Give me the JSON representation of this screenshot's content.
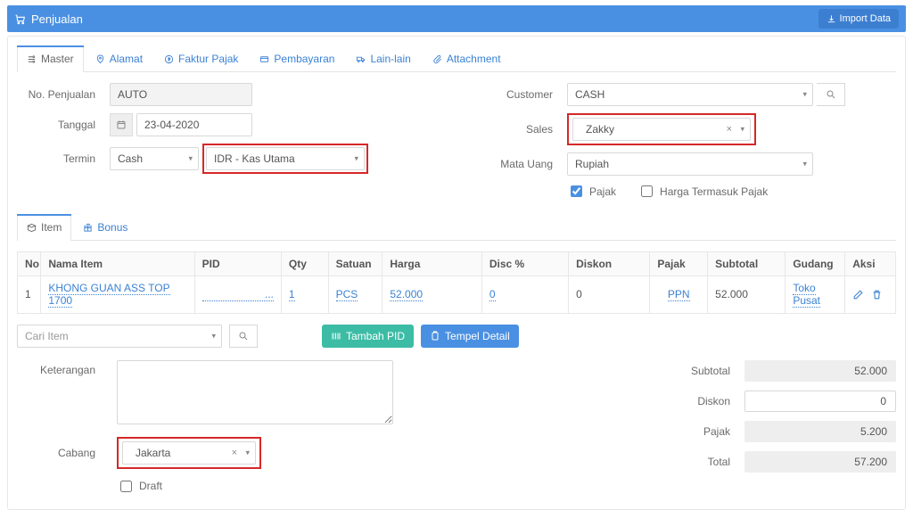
{
  "header": {
    "title": "Penjualan",
    "import_btn": "Import Data"
  },
  "tabs": [
    {
      "label": "Master"
    },
    {
      "label": "Alamat"
    },
    {
      "label": "Faktur Pajak"
    },
    {
      "label": "Pembayaran"
    },
    {
      "label": "Lain-lain"
    },
    {
      "label": "Attachment"
    }
  ],
  "form": {
    "labels": {
      "no_penjualan": "No. Penjualan",
      "tanggal": "Tanggal",
      "termin": "Termin",
      "customer": "Customer",
      "sales": "Sales",
      "mata_uang": "Mata Uang"
    },
    "no_penjualan": "AUTO",
    "tanggal": "23-04-2020",
    "termin": "Cash",
    "kas": "IDR - Kas Utama",
    "customer": "CASH",
    "sales": "Zakky",
    "mata_uang": "Rupiah",
    "pajak_label": "Pajak",
    "pajak_checked": true,
    "harga_termasuk_pajak_label": "Harga Termasuk Pajak",
    "harga_termasuk_pajak_checked": false
  },
  "item_tabs": [
    {
      "label": "Item"
    },
    {
      "label": "Bonus"
    }
  ],
  "item_cols": {
    "no": "No",
    "nama": "Nama Item",
    "pid": "PID",
    "qty": "Qty",
    "satuan": "Satuan",
    "harga": "Harga",
    "disc_pct": "Disc %",
    "diskon": "Diskon",
    "pajak": "Pajak",
    "subtotal": "Subtotal",
    "gudang": "Gudang",
    "aksi": "Aksi"
  },
  "items": [
    {
      "no": "1",
      "nama": "KHONG GUAN ASS TOP 1700",
      "pid": "...",
      "qty": "1",
      "satuan": "PCS",
      "harga": "52.000",
      "disc_pct": "0",
      "diskon": "0",
      "pajak": "PPN",
      "subtotal": "52.000",
      "gudang_l1": "Toko",
      "gudang_l2": "Pusat"
    }
  ],
  "under": {
    "cari_placeholder": "Cari Item",
    "tambah_pid": "Tambah PID",
    "tempel_detail": "Tempel Detail"
  },
  "footer": {
    "keterangan_label": "Keterangan",
    "cabang_label": "Cabang",
    "cabang": "Jakarta",
    "draft_label": "Draft",
    "draft_checked": false
  },
  "totals": {
    "subtotal_label": "Subtotal",
    "subtotal": "52.000",
    "diskon_label": "Diskon",
    "diskon": "0",
    "pajak_label": "Pajak",
    "pajak": "5.200",
    "total_label": "Total",
    "total": "57.200"
  }
}
